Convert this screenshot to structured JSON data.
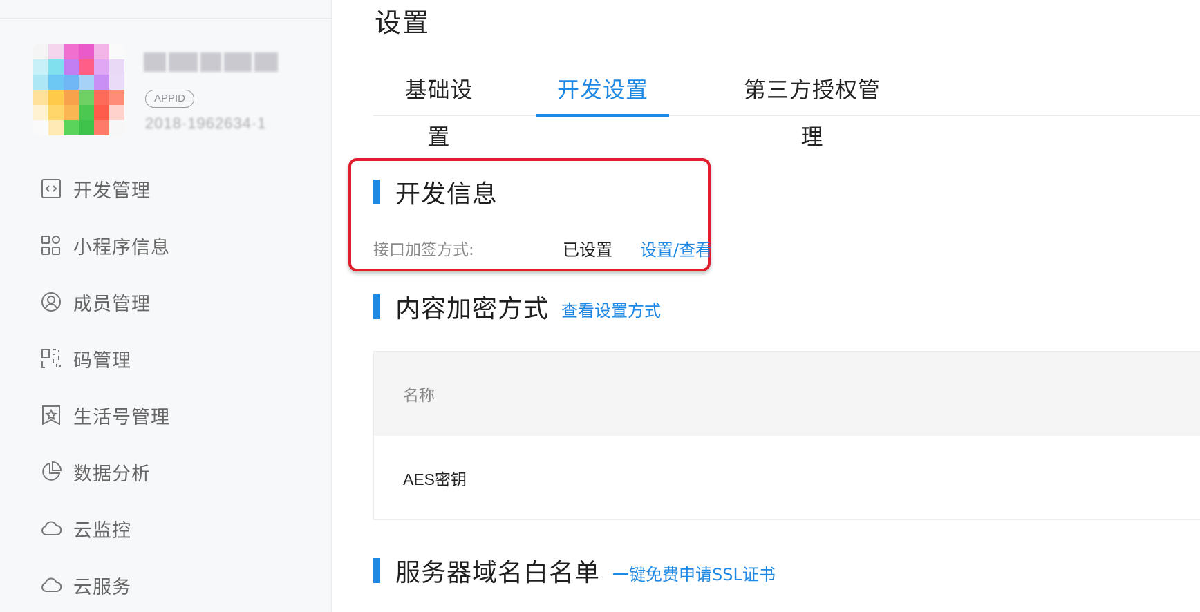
{
  "sidebar": {
    "appid_badge": "APPID",
    "appid_value": "2018·1962634·1",
    "items": [
      {
        "label": "开发管理",
        "icon": "code-icon"
      },
      {
        "label": "小程序信息",
        "icon": "apps-grid-icon"
      },
      {
        "label": "成员管理",
        "icon": "user-circle-icon"
      },
      {
        "label": "码管理",
        "icon": "qrcode-icon"
      },
      {
        "label": "生活号管理",
        "icon": "star-badge-icon"
      },
      {
        "label": "数据分析",
        "icon": "pie-chart-icon"
      },
      {
        "label": "云监控",
        "icon": "cloud-icon"
      },
      {
        "label": "云服务",
        "icon": "cloud-icon"
      }
    ]
  },
  "main": {
    "title": "设置",
    "tabs": [
      {
        "label": "基础设置",
        "active": false
      },
      {
        "label": "开发设置",
        "active": true
      },
      {
        "label": "第三方授权管理",
        "active": false
      }
    ],
    "dev_info": {
      "title": "开发信息",
      "row_label": "接口加签方式:",
      "row_status": "已设置",
      "row_link": "设置/查看"
    },
    "encryption": {
      "title": "内容加密方式",
      "link": "查看设置方式",
      "table_header": "名称",
      "table_row": "AES密钥"
    },
    "whitelist": {
      "title": "服务器域名白名单",
      "link": "一键免费申请SSL证书"
    }
  },
  "colors": {
    "accent": "#1e88e5",
    "highlight": "#e11d2e",
    "sidebar_bg": "#f7f8fa"
  }
}
